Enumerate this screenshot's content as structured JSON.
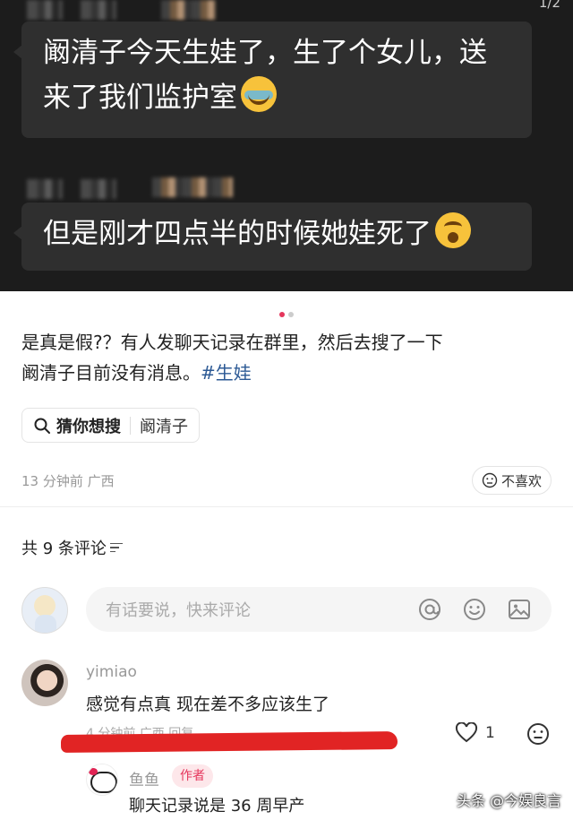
{
  "chat_image": {
    "page_indicator": "1/2",
    "messages": [
      {
        "text": "阚清子今天生娃了，生了个女儿，送来了我们监护室",
        "emoji": "crying-face-emoji"
      },
      {
        "text": "但是刚才四点半的时候她娃死了",
        "emoji": "shocked-face-emoji"
      }
    ]
  },
  "carousel": {
    "count": 2,
    "active_index": 0
  },
  "post": {
    "text_line1": "是真是假?？有人发聊天记录在群里，然后去搜了一下",
    "text_line2": "阚清子目前没有消息。",
    "tag": "#生娃"
  },
  "search_chip": {
    "label": "猜你想搜",
    "keyword": "阚清子"
  },
  "meta": {
    "time_location": "13 分钟前 广西",
    "dislike_label": "不喜欢"
  },
  "comments_header": {
    "label": "共 9 条评论"
  },
  "comment_box": {
    "placeholder": "有话要说，快来评论",
    "icons": [
      "at-icon",
      "emoji-icon",
      "image-icon"
    ]
  },
  "comments": [
    {
      "username": "yimiao",
      "text": "感觉有点真 现在差不多应该生了",
      "meta": "4 分钟前 广西 回复",
      "likes": "1"
    }
  ],
  "reply": {
    "username": "鱼鱼",
    "badge": "作者",
    "text": "聊天记录说是 36 周早产"
  },
  "watermark": "头条 @今娱良言",
  "colors": {
    "accent": "#e5365c",
    "tag": "#2d5a95",
    "redline": "#e12424"
  }
}
